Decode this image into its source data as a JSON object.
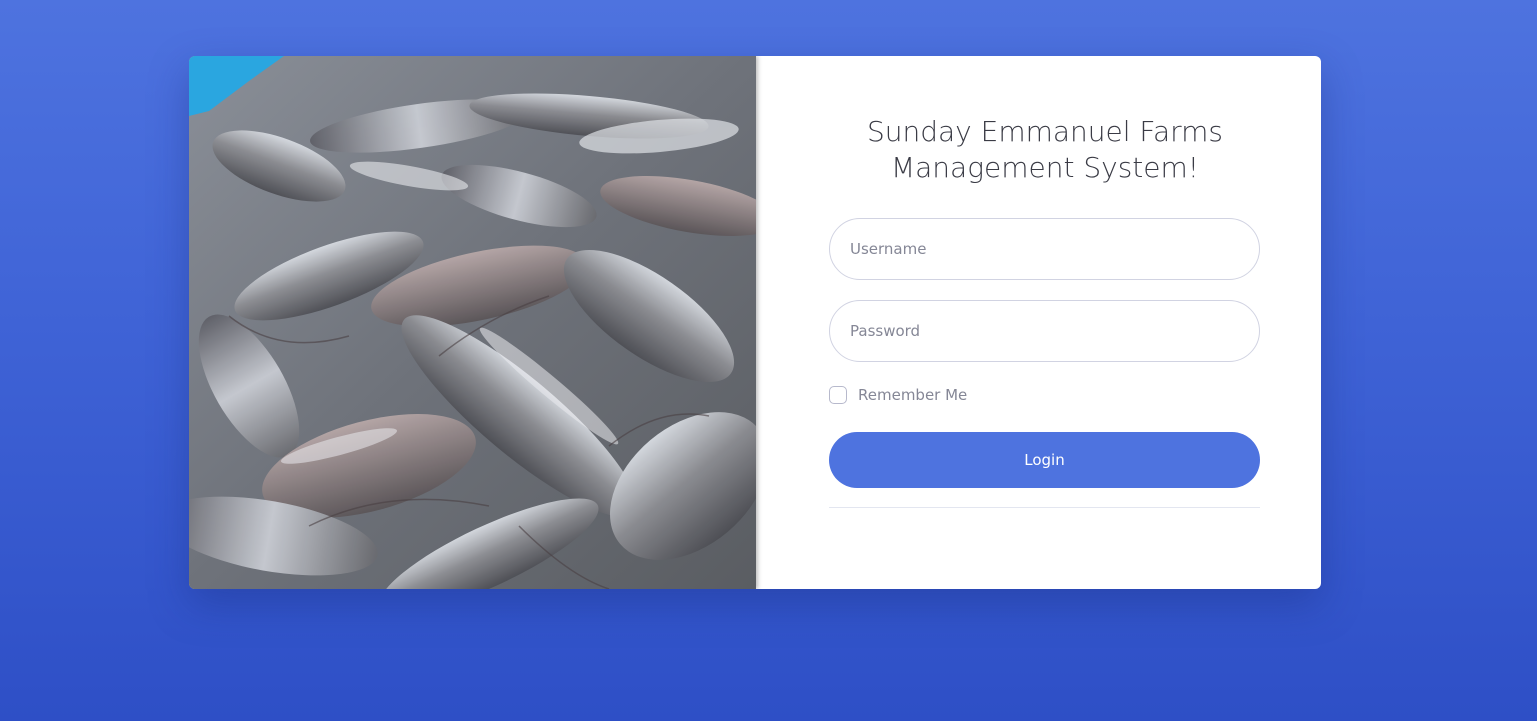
{
  "login": {
    "title_line1": "Sunday Emmanuel Farms",
    "title_line2": "Management System!",
    "username_placeholder": "Username",
    "password_placeholder": "Password",
    "remember_label": "Remember Me",
    "login_label": "Login"
  },
  "image": {
    "subject": "catfish-photo"
  },
  "colors": {
    "accent": "#4e73df",
    "background_top": "#4e73df",
    "background_bottom": "#2e4fc6",
    "title_text": "#3a3b45",
    "muted_text": "#858796"
  }
}
